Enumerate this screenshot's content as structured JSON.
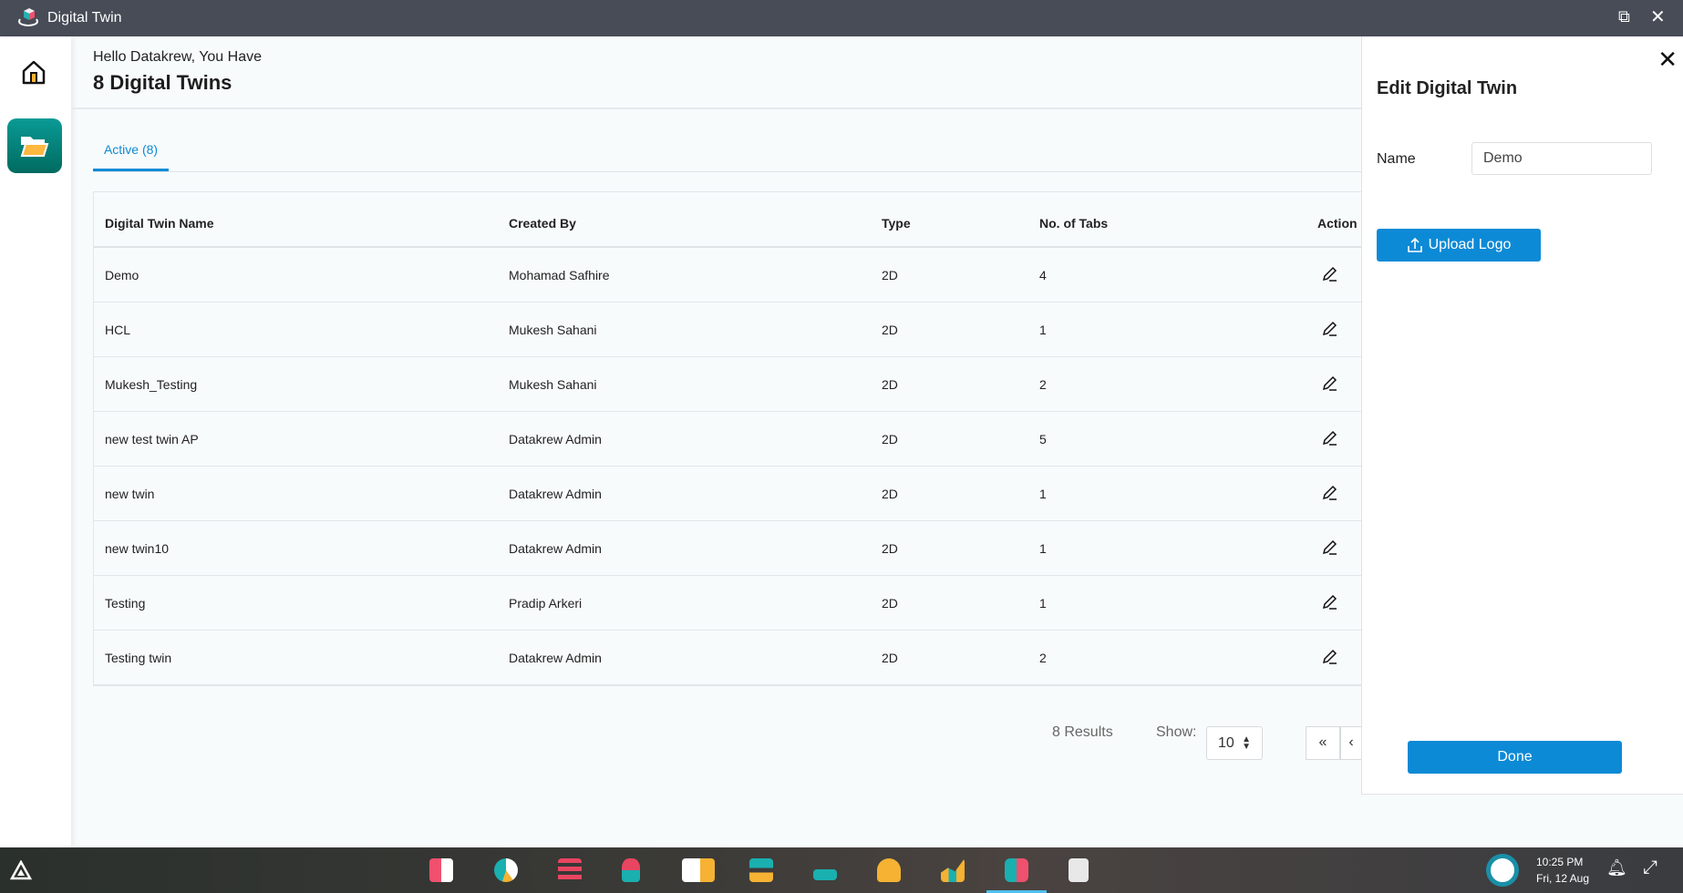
{
  "window": {
    "title": "Digital Twin"
  },
  "header": {
    "greeting": "Hello Datakrew, You Have",
    "count_title": "8 Digital Twins"
  },
  "tabs": [
    {
      "label": "Active (8)",
      "active": true
    }
  ],
  "table": {
    "columns": [
      "Digital Twin Name",
      "Created By",
      "Type",
      "No. of Tabs",
      "Action"
    ],
    "rows": [
      [
        "Demo",
        "Mohamad Safhire",
        "2D",
        "4"
      ],
      [
        "HCL",
        "Mukesh Sahani",
        "2D",
        "1"
      ],
      [
        "Mukesh_Testing",
        "Mukesh Sahani",
        "2D",
        "2"
      ],
      [
        "new test twin AP",
        "Datakrew Admin",
        "2D",
        "5"
      ],
      [
        "new twin",
        "Datakrew Admin",
        "2D",
        "1"
      ],
      [
        "new twin10",
        "Datakrew Admin",
        "2D",
        "1"
      ],
      [
        "Testing",
        "Pradip Arkeri",
        "2D",
        "1"
      ],
      [
        "Testing twin",
        "Datakrew Admin",
        "2D",
        "2"
      ]
    ]
  },
  "pagination": {
    "results": "8 Results",
    "show_label": "Show:",
    "page_size": "10",
    "first": "«",
    "prev": "‹"
  },
  "panel": {
    "title": "Edit Digital Twin",
    "name_label": "Name",
    "name_value": "Demo",
    "upload_label": "Upload Logo",
    "done_label": "Done"
  },
  "taskbar": {
    "time": "10:25 PM",
    "date": "Fri, 12 Aug"
  },
  "colors": {
    "accent": "#0d8ad6",
    "titlebar": "#474c57",
    "sidebar_active": "#00897b"
  }
}
